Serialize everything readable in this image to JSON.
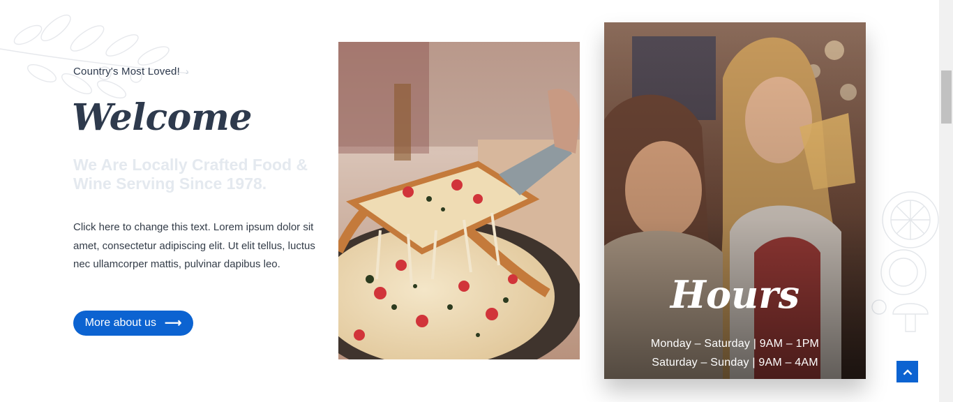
{
  "intro": {
    "eyebrow": "Country's Most Loved!",
    "heading": "Welcome",
    "subheading": "We Are Locally Crafted Food & Wine Serving Since 1978.",
    "body": "Click here to change this text. Lorem ipsum dolor sit amet, consectetur adipiscing elit. Ut elit tellus, luctus nec ullamcorper mattis, pulvinar dapibus leo.",
    "button_label": "More about us",
    "button_icon": "arrow-right-icon"
  },
  "hours": {
    "title": "Hours",
    "lines": [
      "Monday – Saturday | 9AM – 1PM",
      "Saturday – Sunday | 9AM – 4AM"
    ]
  },
  "images": {
    "pizza": "pizza-slice-photo",
    "people": "women-dining-photo"
  },
  "colors": {
    "accent": "#0c63d1",
    "heading": "#2e3a4d",
    "subheading": "#e4e9ef"
  },
  "scroll_top_icon": "chevron-up-icon"
}
